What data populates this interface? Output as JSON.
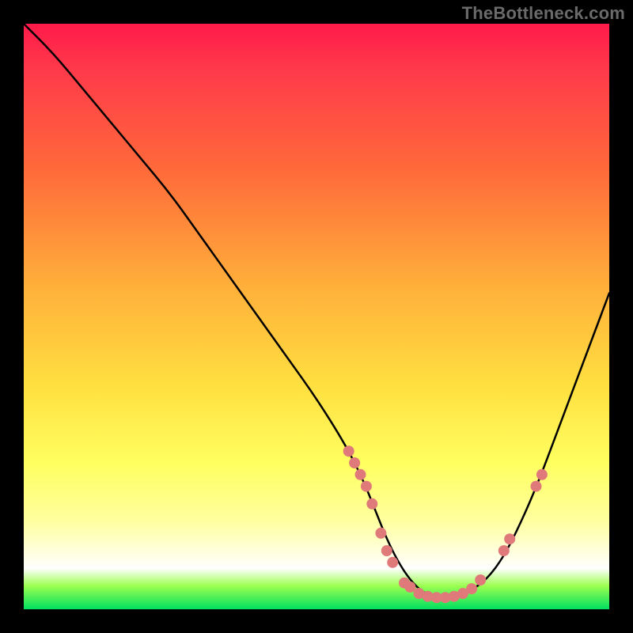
{
  "watermark": "TheBottleneck.com",
  "chart_data": {
    "type": "line",
    "title": "",
    "xlabel": "",
    "ylabel": "",
    "xlim": [
      0,
      100
    ],
    "ylim": [
      0,
      100
    ],
    "series": [
      {
        "name": "curve",
        "x": [
          0,
          5,
          10,
          15,
          20,
          25,
          30,
          35,
          40,
          45,
          50,
          55,
          58,
          60,
          62,
          64,
          66,
          68,
          70,
          73,
          76,
          79,
          82,
          85,
          88,
          91,
          94,
          97,
          100
        ],
        "y": [
          100,
          95,
          89,
          83,
          77,
          71,
          64,
          57,
          50,
          43,
          36,
          28,
          22,
          17,
          12,
          8,
          5,
          3,
          2,
          2,
          3,
          5,
          9,
          15,
          22,
          30,
          38,
          46,
          54
        ]
      }
    ],
    "markers": [
      {
        "x": 55.5,
        "y": 27
      },
      {
        "x": 56.5,
        "y": 25
      },
      {
        "x": 57.5,
        "y": 23
      },
      {
        "x": 58.5,
        "y": 21
      },
      {
        "x": 59.5,
        "y": 18
      },
      {
        "x": 61.0,
        "y": 13
      },
      {
        "x": 62.0,
        "y": 10
      },
      {
        "x": 63.0,
        "y": 8
      },
      {
        "x": 65.0,
        "y": 4.5
      },
      {
        "x": 66.0,
        "y": 3.8
      },
      {
        "x": 67.5,
        "y": 2.7
      },
      {
        "x": 69.0,
        "y": 2.2
      },
      {
        "x": 70.5,
        "y": 2.0
      },
      {
        "x": 72.0,
        "y": 2.0
      },
      {
        "x": 73.5,
        "y": 2.2
      },
      {
        "x": 75.0,
        "y": 2.7
      },
      {
        "x": 76.5,
        "y": 3.5
      },
      {
        "x": 78.0,
        "y": 5
      },
      {
        "x": 82.0,
        "y": 10
      },
      {
        "x": 83.0,
        "y": 12
      },
      {
        "x": 87.5,
        "y": 21
      },
      {
        "x": 88.5,
        "y": 23
      }
    ],
    "marker_color": "#e07a7a",
    "curve_color": "#000000",
    "gradient_stops": [
      {
        "pos": 0.0,
        "color": "#ff1a4a"
      },
      {
        "pos": 0.25,
        "color": "#ff6a3a"
      },
      {
        "pos": 0.5,
        "color": "#ffd040"
      },
      {
        "pos": 0.75,
        "color": "#ffff60"
      },
      {
        "pos": 0.93,
        "color": "#ffffff"
      },
      {
        "pos": 1.0,
        "color": "#00e060"
      }
    ]
  }
}
